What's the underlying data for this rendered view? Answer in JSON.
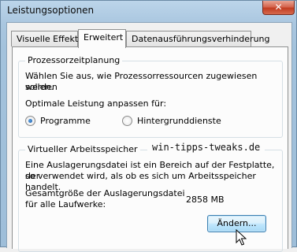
{
  "window": {
    "title": "Leistungsoptionen",
    "close_glyph": "✕"
  },
  "tabs": [
    {
      "label": "Visuelle Effekte",
      "active": false
    },
    {
      "label": "Erweitert",
      "active": true
    },
    {
      "label": "Datenausführungsverhinderung",
      "active": false
    }
  ],
  "processor": {
    "title": "Prozessorzeitplanung",
    "desc_line1": "Wählen Sie aus, wie Prozessorressourcen zugewiesen werden",
    "desc_line2": "sollen.",
    "adjust_label": "Optimale Leistung anpassen für:",
    "options": [
      {
        "label": "Programme",
        "checked": true
      },
      {
        "label": "Hintergrunddienste",
        "checked": false
      }
    ]
  },
  "virtual_memory": {
    "title": "Virtueller Arbeitsspeicher",
    "desc_line1": "Eine Auslagerungsdatei ist ein Bereich auf der Festplatte, der",
    "desc_line2": "so verwendet wird, als ob es sich um Arbeitsspeicher handelt.",
    "size_label_line1": "Gesamtgröße der Auslagerungsdatei",
    "size_label_line2": "für alle Laufwerke:",
    "size_value": "2858 MB",
    "change_button": "Ändern..."
  },
  "watermark": "win-tipps-tweaks.de",
  "icons": {
    "close": "close-icon",
    "cursor": "mouse-pointer-icon"
  }
}
